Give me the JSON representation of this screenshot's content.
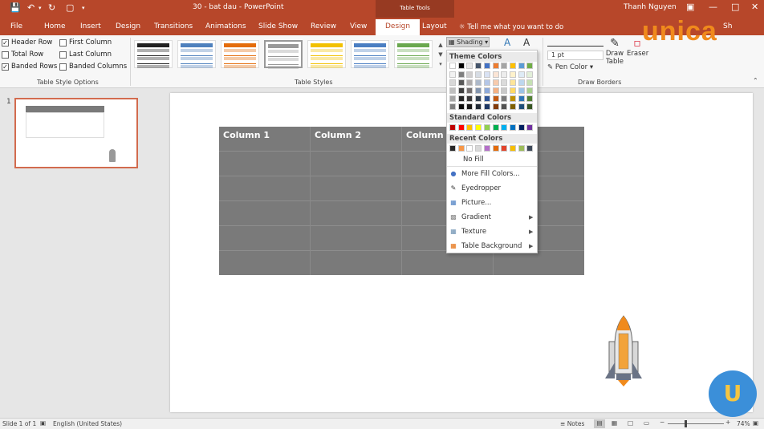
{
  "title": "30 - bat dau  -  PowerPoint",
  "contextual_label": "Table Tools",
  "user": "Thanh Nguyen",
  "share": "Sh",
  "tell_me": "Tell me what you want to do",
  "tabs": [
    "File",
    "Home",
    "Insert",
    "Design",
    "Transitions",
    "Animations",
    "Slide Show",
    "Review",
    "View",
    "Design",
    "Layout"
  ],
  "options": {
    "col1": [
      "Header Row",
      "Total Row",
      "Banded Rows"
    ],
    "col1_checked": [
      true,
      false,
      true
    ],
    "col2": [
      "First Column",
      "Last Column",
      "Banded Columns"
    ],
    "col2_checked": [
      false,
      false,
      false
    ],
    "group_label": "Table Style Options"
  },
  "styles_label": "Table Styles",
  "style_colors": [
    "#222222",
    "#4f81bd",
    "#e46c0a",
    "#999999",
    "#f2c100",
    "#4a7ec2",
    "#6aa84f"
  ],
  "shading": {
    "label": "Shading",
    "width_value": "1 pt",
    "pen_color": "Pen Color",
    "draw_table": "Draw Table",
    "eraser": "Eraser",
    "group_label": "Draw Borders"
  },
  "dropdown": {
    "theme_colors_label": "Theme Colors",
    "theme_top": [
      "#ffffff",
      "#000000",
      "#e7e6e6",
      "#44546a",
      "#4472c4",
      "#ed7d31",
      "#a5a5a5",
      "#ffc000",
      "#5b9bd5",
      "#70ad47"
    ],
    "theme_shades": [
      [
        "#f2f2f2",
        "#7f7f7f",
        "#d0cece",
        "#d6dce4",
        "#d9e2f3",
        "#fbe5d5",
        "#ededed",
        "#fff2cc",
        "#deebf6",
        "#e2efd9"
      ],
      [
        "#d8d8d8",
        "#595959",
        "#aeabab",
        "#adb9ca",
        "#b4c6e7",
        "#f7cbac",
        "#dbdbdb",
        "#fee599",
        "#bdd7ee",
        "#c5e0b3"
      ],
      [
        "#bfbfbf",
        "#3f3f3f",
        "#757070",
        "#8496b0",
        "#8eaadb",
        "#f4b183",
        "#c9c9c9",
        "#ffd965",
        "#9cc3e5",
        "#a8d08d"
      ],
      [
        "#a5a5a5",
        "#262626",
        "#3a3838",
        "#323f4f",
        "#2f5496",
        "#c55a11",
        "#7b7b7b",
        "#bf9000",
        "#2e75b5",
        "#538135"
      ],
      [
        "#7f7f7f",
        "#0c0c0c",
        "#171616",
        "#222a35",
        "#1f3864",
        "#833c0b",
        "#525252",
        "#7f6000",
        "#1e4e79",
        "#375623"
      ]
    ],
    "standard_label": "Standard Colors",
    "standard": [
      "#c00000",
      "#ff0000",
      "#ffc000",
      "#ffff00",
      "#92d050",
      "#00b050",
      "#00b0f0",
      "#0070c0",
      "#002060",
      "#7030a0"
    ],
    "recent_label": "Recent Colors",
    "recent": [
      "#262626",
      "#f79646",
      "#ffffff",
      "#d9d9d9",
      "#b46fc9",
      "#e46c0a",
      "#e2432b",
      "#f6be00",
      "#9bbb59",
      "#3f4a5a"
    ],
    "items": [
      "No Fill",
      "More Fill Colors...",
      "Eyedropper",
      "Picture...",
      "Gradient",
      "Texture",
      "Table Background"
    ]
  },
  "table": {
    "columns": [
      "Column 1",
      "Column 2",
      "Column 3"
    ]
  },
  "slide_num": "1",
  "status": {
    "slide": "Slide 1 of 1",
    "language": "English (United States)",
    "notes": "Notes",
    "zoom": "74%"
  },
  "colors": {
    "accent": "#b7472a",
    "table": "#7a7a7a"
  },
  "brand": "unica"
}
